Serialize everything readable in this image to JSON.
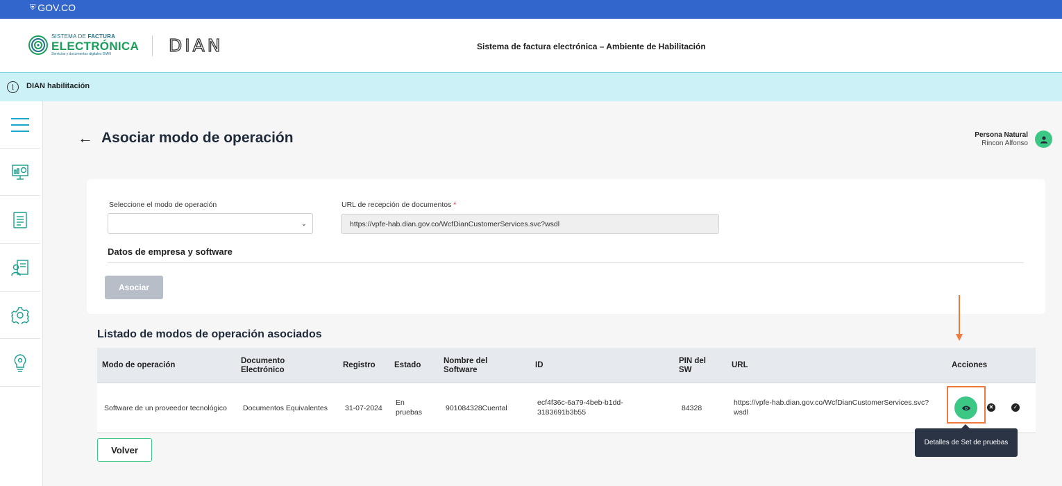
{
  "govbar": {
    "label": "GOV.CO"
  },
  "header": {
    "logo": {
      "line1_a": "SISTEMA DE ",
      "line1_b": "FACTURA",
      "line2": "ELECTRÓNICA",
      "line3": "Servicios y documentos digitales DIAN"
    },
    "dian_logo": "DIAN",
    "title": "Sistema de factura electrónica – Ambiente de Habilitación"
  },
  "infobar": {
    "icon": "info-icon",
    "text": "DIAN habilitación"
  },
  "sidebar": {
    "items": [
      {
        "icon": "menu-icon"
      },
      {
        "icon": "monitor-chart-icon"
      },
      {
        "icon": "document-list-icon"
      },
      {
        "icon": "user-document-icon"
      },
      {
        "icon": "gear-icon"
      },
      {
        "icon": "lightbulb-gear-icon"
      }
    ]
  },
  "page": {
    "title": "Asociar modo de operación"
  },
  "user": {
    "role": "Persona Natural",
    "name": "Rincon Alfonso"
  },
  "form": {
    "mode_label": "Seleccione el modo de operación",
    "mode_value": "",
    "url_label": "URL de recepción de documentos",
    "url_required": "*",
    "url_value": "https://vpfe-hab.dian.gov.co/WcfDianCustomerServices.svc?wsdl",
    "section_title": "Datos de empresa y software",
    "submit_label": "Asociar"
  },
  "list": {
    "title": "Listado de modos de operación asociados",
    "columns": {
      "mode": "Modo de operación",
      "doc_1": "Documento",
      "doc_2": "Electrónico",
      "registro": "Registro",
      "estado": "Estado",
      "software_1": "Nombre del",
      "software_2": "Software",
      "id": "ID",
      "pin_1": "PIN del",
      "pin_2": "SW",
      "url": "URL",
      "acciones": "Acciones"
    },
    "rows": [
      {
        "mode": "Software de un proveedor tecnológico",
        "doc": "Documentos Equivalentes",
        "registro": "31-07-2024",
        "estado_1": "En",
        "estado_2": "pruebas",
        "software": "901084328Cuental",
        "id_1": "ecf4f36c-6a79-4beb-b1dd-",
        "id_2": "3183691b3b55",
        "pin": "84328",
        "url_1": "https://vpfe-hab.dian.gov.co/WcfDianCustomerServices.svc?",
        "url_2": "wsdl"
      }
    ]
  },
  "tooltip": {
    "text": "Detalles de Set de pruebas"
  },
  "back_button": {
    "label": "Volver"
  },
  "colors": {
    "gov_blue": "#3366cc",
    "accent_green": "#3cc884",
    "info_bg": "#ccf2f8",
    "highlight_orange": "#f07a3c"
  }
}
